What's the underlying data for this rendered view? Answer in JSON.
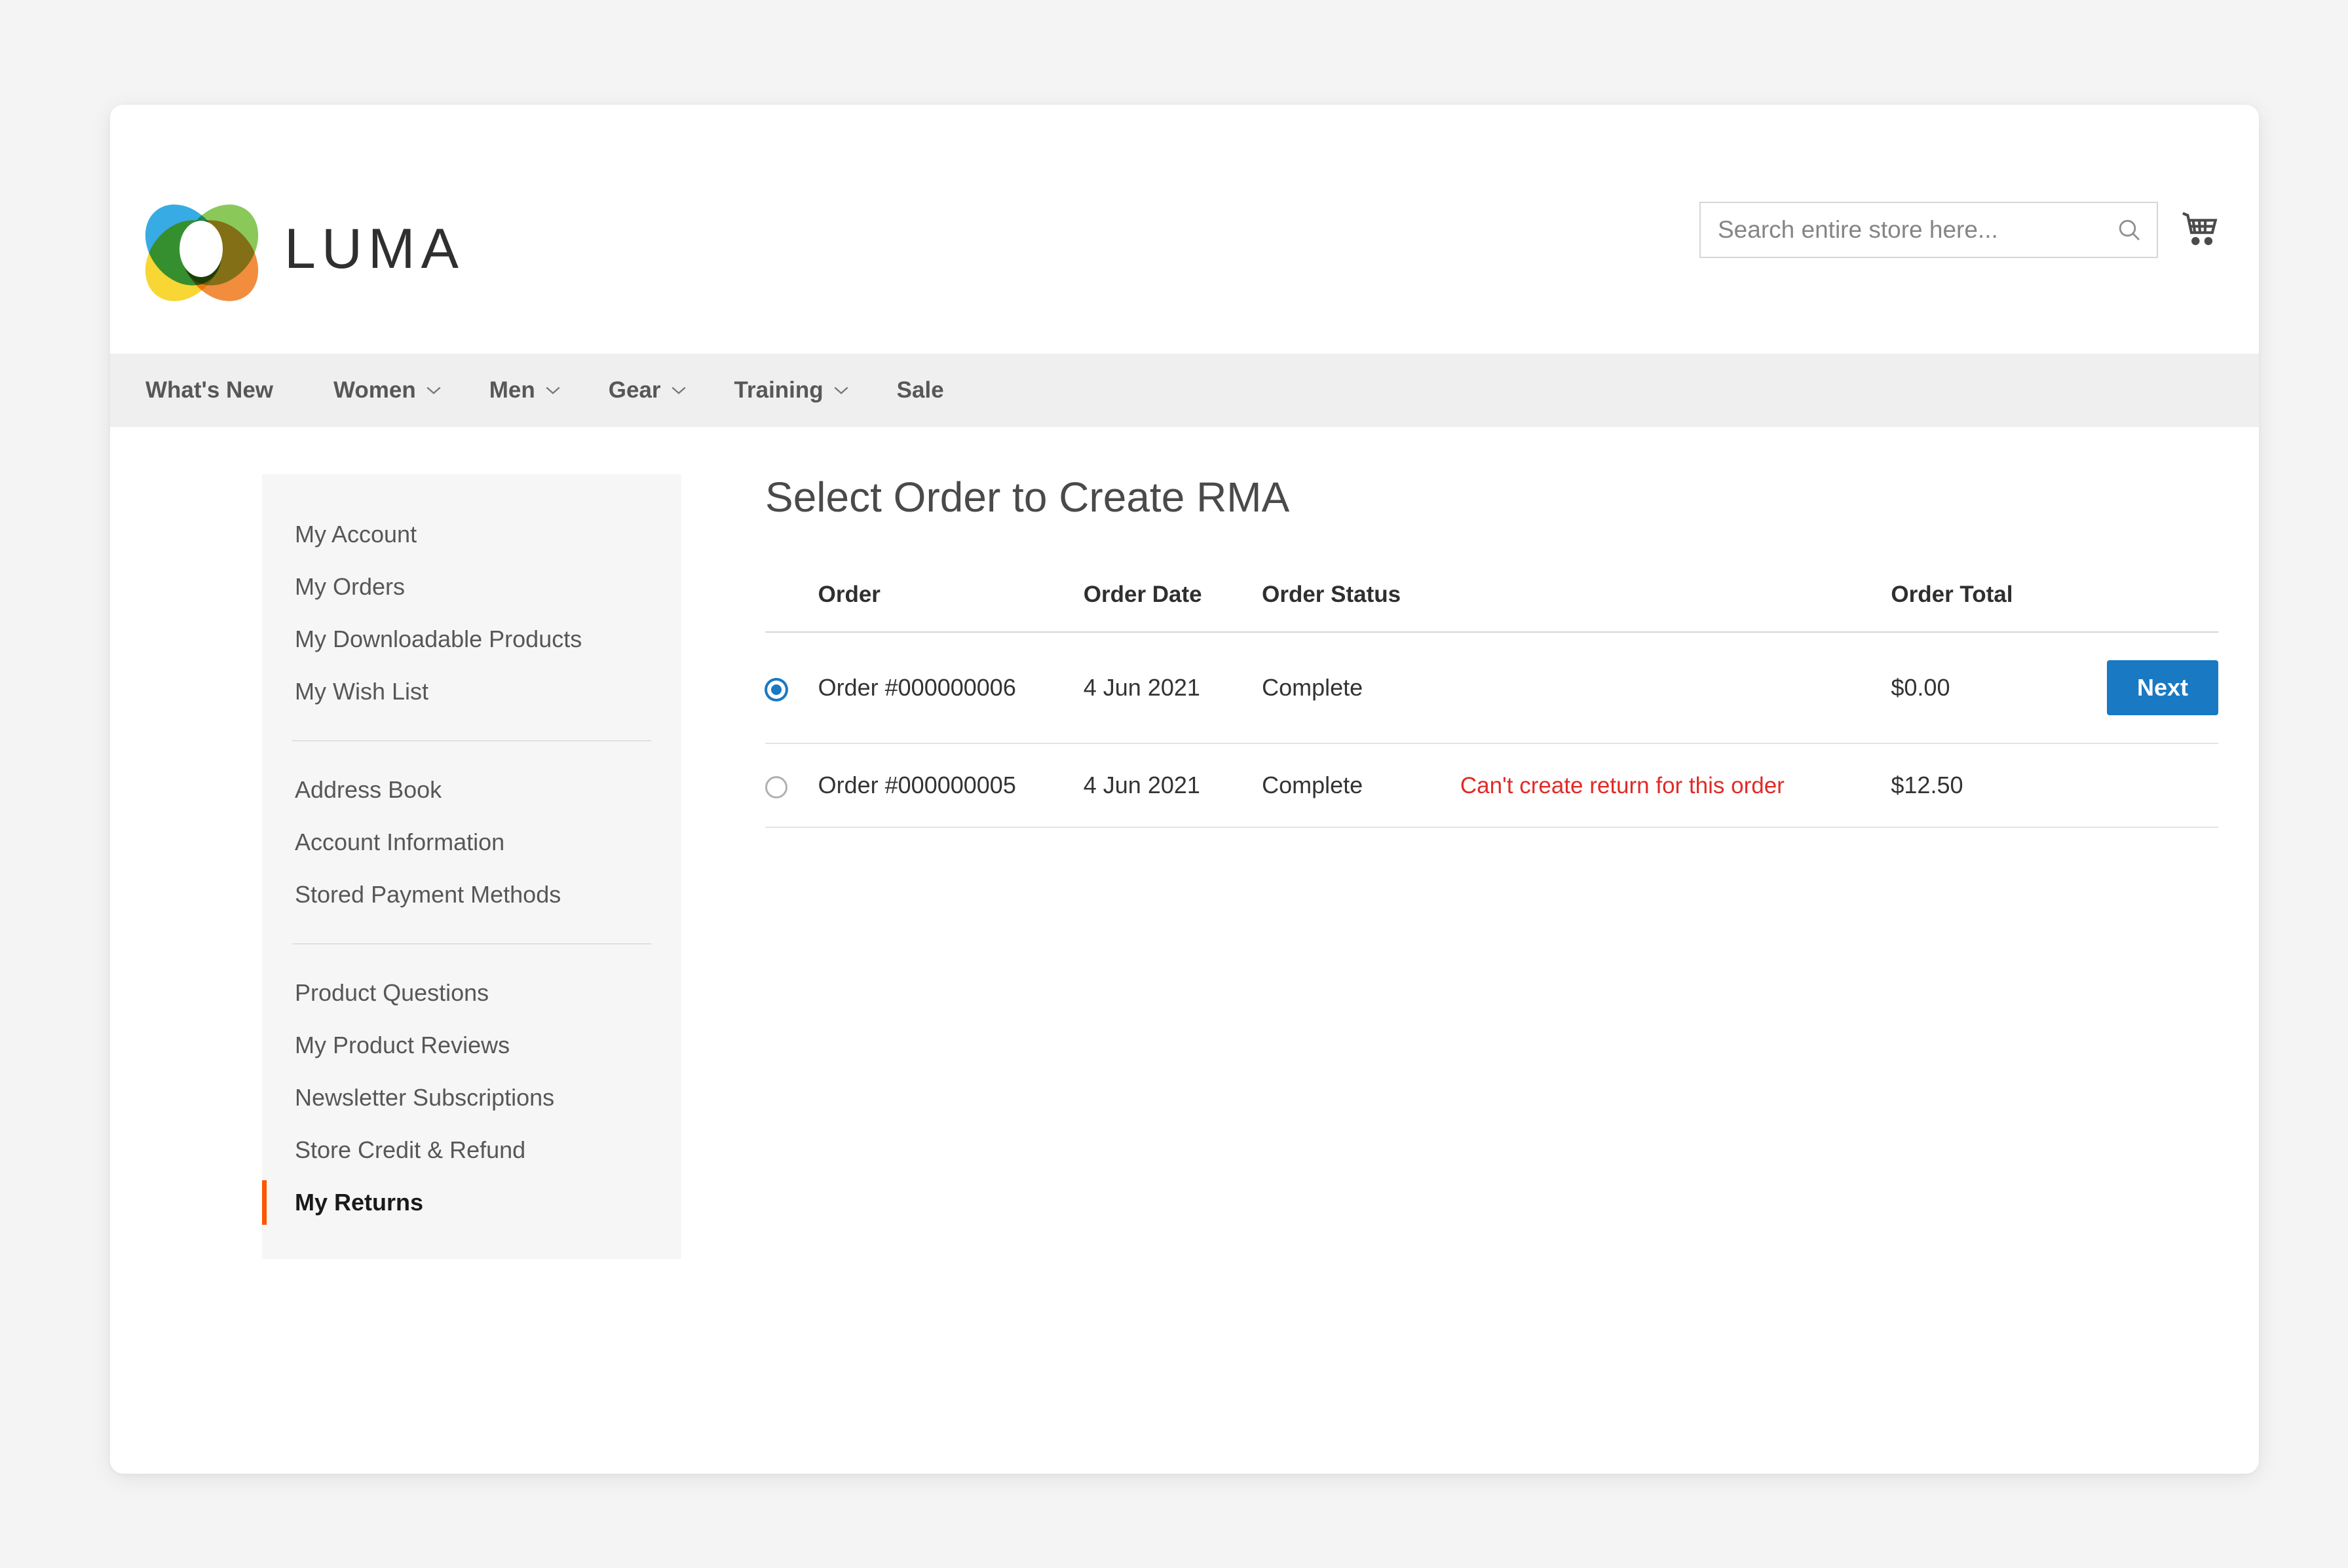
{
  "header": {
    "logo_text": "LUMA",
    "logo_icon": "luma-ring-logo",
    "search": {
      "placeholder": "Search entire store here...",
      "value": "",
      "icon": "search-icon"
    },
    "cart_icon": "shopping-cart-icon"
  },
  "nav": {
    "items": [
      {
        "label": "What's New",
        "has_caret": false
      },
      {
        "label": "Women",
        "has_caret": true
      },
      {
        "label": "Men",
        "has_caret": true
      },
      {
        "label": "Gear",
        "has_caret": true
      },
      {
        "label": "Training",
        "has_caret": true
      },
      {
        "label": "Sale",
        "has_caret": false
      }
    ]
  },
  "sidebar": {
    "groups": [
      {
        "items": [
          {
            "label": "My Account",
            "active": false
          },
          {
            "label": "My Orders",
            "active": false
          },
          {
            "label": "My Downloadable Products",
            "active": false
          },
          {
            "label": "My Wish List",
            "active": false
          }
        ]
      },
      {
        "items": [
          {
            "label": "Address Book",
            "active": false
          },
          {
            "label": "Account Information",
            "active": false
          },
          {
            "label": "Stored Payment Methods",
            "active": false
          }
        ]
      },
      {
        "items": [
          {
            "label": "Product Questions",
            "active": false
          },
          {
            "label": "My Product Reviews",
            "active": false
          },
          {
            "label": "Newsletter Subscriptions",
            "active": false
          },
          {
            "label": "Store Credit & Refund",
            "active": false
          },
          {
            "label": "My Returns",
            "active": true
          }
        ]
      }
    ]
  },
  "main": {
    "title": "Select Order to Create RMA",
    "table": {
      "columns": [
        "",
        "Order",
        "Order Date",
        "Order Status",
        "",
        "Order Total",
        ""
      ],
      "rows": [
        {
          "selected": true,
          "order": "Order #000000006",
          "order_date": "4 Jun 2021",
          "order_status": "Complete",
          "note": "",
          "order_total": "$0.00",
          "action_label": "Next",
          "has_action": true
        },
        {
          "selected": false,
          "order": "Order #000000005",
          "order_date": "4 Jun 2021",
          "order_status": "Complete",
          "note": "Can't create return for this order",
          "order_total": "$12.50",
          "action_label": "",
          "has_action": false
        }
      ]
    }
  },
  "colors": {
    "primary_blue": "#1979c3",
    "error_red": "#e02b27",
    "active_orange": "#ff5501",
    "nav_bg": "#efefef",
    "sidebar_bg": "#f6f6f6",
    "page_bg": "#f4f4f4"
  }
}
